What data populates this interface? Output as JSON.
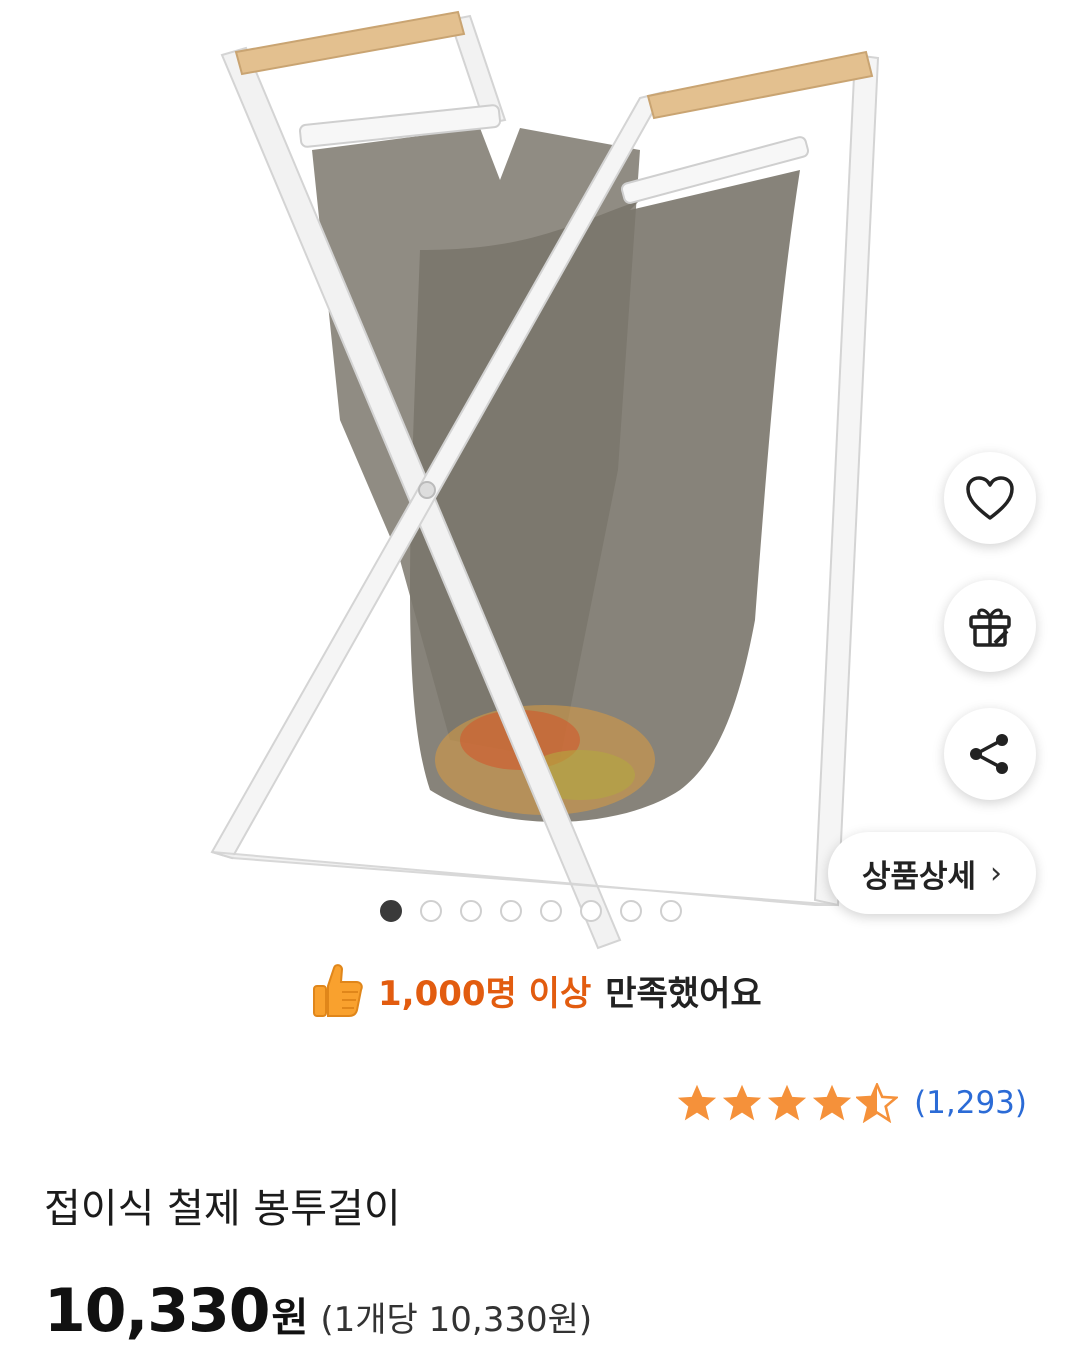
{
  "product": {
    "title": "접이식 철제 봉투걸이",
    "image_dots_total": 8,
    "image_dots_active": 0
  },
  "actions": {
    "wishlist_icon": "heart-icon",
    "gift_icon": "gift-icon",
    "share_icon": "share-icon",
    "detail_label": "상품상세",
    "detail_chevron": "›"
  },
  "satisfaction": {
    "icon": "thumbs-up-icon",
    "highlight": "1,000명 이상",
    "rest": "만족했어요"
  },
  "rating": {
    "stars": 4.5,
    "count": "(1,293)"
  },
  "price": {
    "amount": "10,330",
    "unit": "원",
    "per_unit": "(1개당 10,330원)"
  },
  "colors": {
    "accent_orange": "#e25c0f",
    "star_orange": "#f5913a",
    "link_blue": "#2b6bd6"
  }
}
